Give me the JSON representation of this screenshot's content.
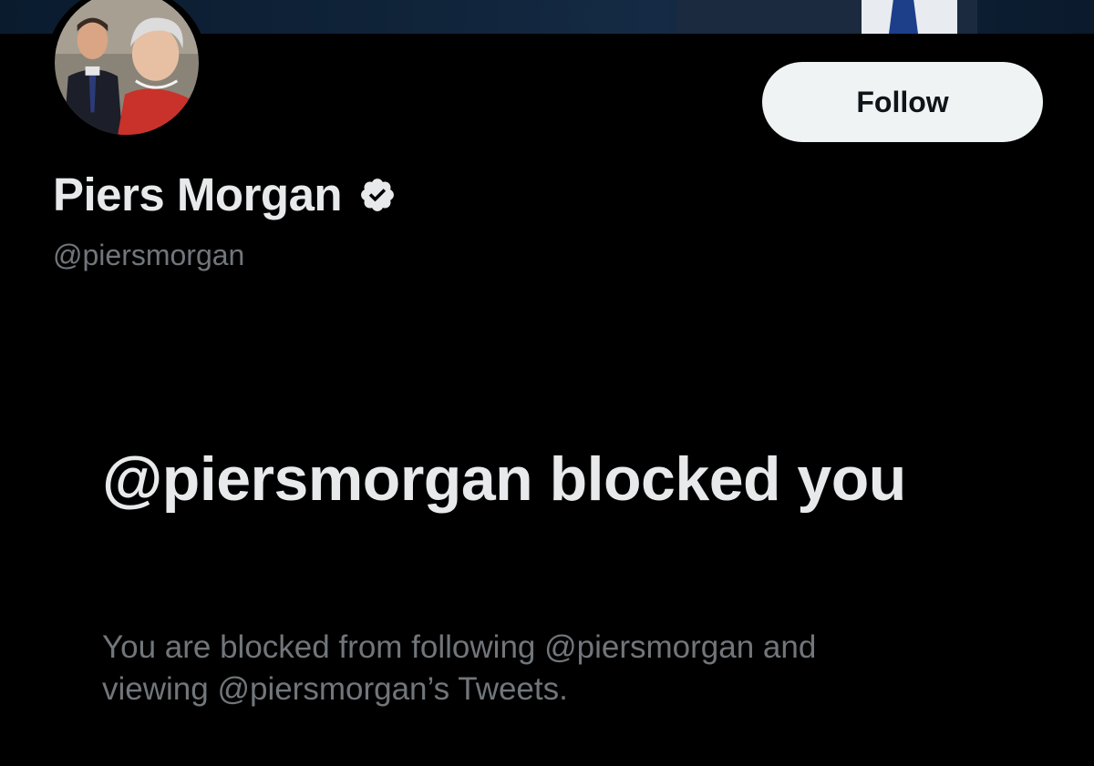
{
  "profile": {
    "display_name": "Piers Morgan",
    "verified": true,
    "verified_icon": "verified-badge-icon",
    "handle": "@piersmorgan",
    "avatar": "profile-avatar-photo",
    "follow_label": "Follow"
  },
  "blocked": {
    "title": "@piersmorgan blocked you",
    "description": "You are blocked from following @piersmorgan and viewing @piersmorgan’s Tweets."
  },
  "colors": {
    "background": "#000000",
    "primary_text": "#e7e9ea",
    "secondary_text": "#71767b",
    "button_bg": "#eff3f4",
    "button_text": "#0f1419"
  }
}
